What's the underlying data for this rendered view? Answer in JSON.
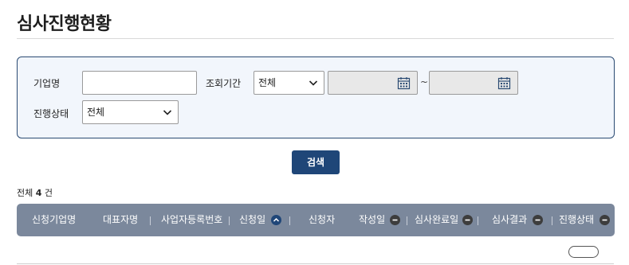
{
  "page": {
    "title": "심사진행현황"
  },
  "filters": {
    "company_label": "기업명",
    "company_value": "",
    "period_label": "조회기간",
    "period_selected": "전체",
    "date_from": "",
    "date_to": "",
    "tilde": "~",
    "status_label": "진행상태",
    "status_selected": "전체"
  },
  "actions": {
    "search_label": "검색"
  },
  "summary": {
    "prefix": "전체",
    "count": "4",
    "suffix": "건"
  },
  "table": {
    "columns": [
      {
        "label": "신청기업명",
        "sort": "none"
      },
      {
        "label": "대표자명",
        "sort": "none"
      },
      {
        "label": "사업자등록번호",
        "sort": "none"
      },
      {
        "label": "신청일",
        "sort": "asc"
      },
      {
        "label": "신청자",
        "sort": "none"
      },
      {
        "label": "작성일",
        "sort": "off"
      },
      {
        "label": "심사완료일",
        "sort": "off"
      },
      {
        "label": "심사결과",
        "sort": "off"
      },
      {
        "label": "진행상태",
        "sort": "off"
      }
    ],
    "rows": []
  },
  "colors": {
    "accent": "#1f4678",
    "header_bg": "#7b889c",
    "panel_bg": "#f2f6fc",
    "panel_border": "#2a4a72"
  },
  "icons": {
    "dropdown": "chevron-down-icon",
    "calendar": "calendar-icon",
    "sort_asc": "sort-ascending-icon",
    "sort_off": "sort-minus-icon"
  }
}
